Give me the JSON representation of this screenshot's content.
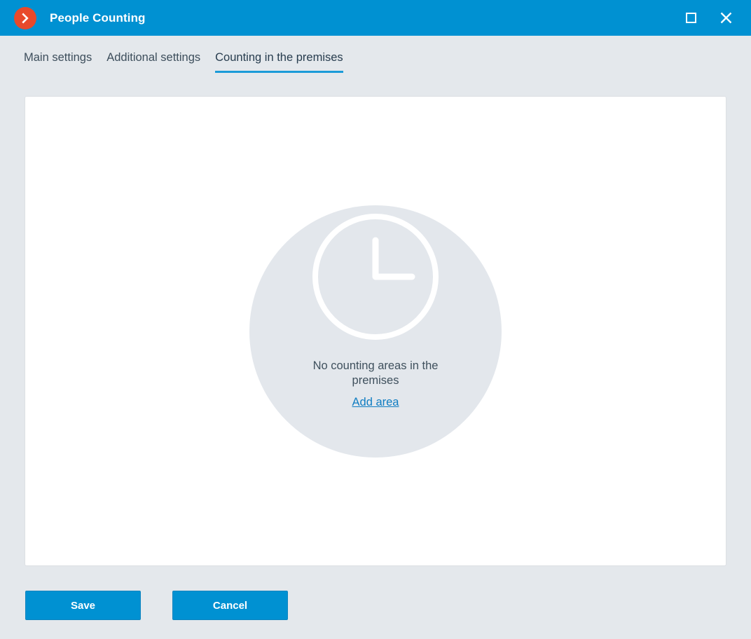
{
  "window": {
    "title": "People Counting",
    "logo_icon": "chevron-right-circle-icon",
    "maximize_icon": "maximize-icon",
    "close_icon": "close-icon"
  },
  "tabs": [
    {
      "label": "Main settings",
      "active": false
    },
    {
      "label": "Additional settings",
      "active": false
    },
    {
      "label": "Counting in the premises",
      "active": true
    }
  ],
  "content": {
    "empty_state": {
      "icon": "clock-icon",
      "message": "No counting areas in the premises",
      "link_label": "Add area"
    }
  },
  "footer": {
    "save_label": "Save",
    "cancel_label": "Cancel"
  },
  "colors": {
    "titlebar_blue": "#0091d2",
    "accent_blue": "#1b9bd8",
    "logo_orange": "#e8492a",
    "link_blue": "#0f7dc2",
    "page_background": "#e4e8ec",
    "panel_background": "#ffffff",
    "empty_circle": "#e3e7ec",
    "text_dark": "#3f505d"
  }
}
